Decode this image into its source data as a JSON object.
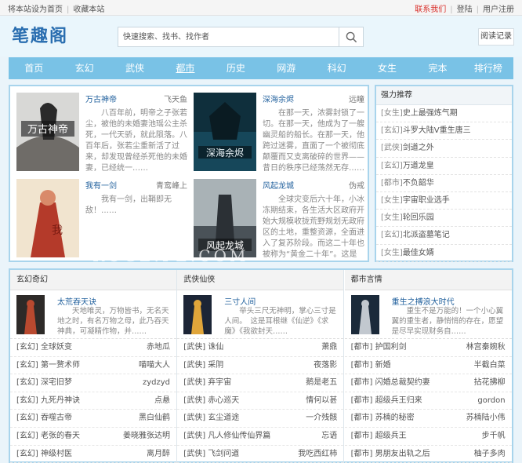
{
  "topbar": {
    "set_home": "将本站设为首页",
    "bookmark": "收藏本站",
    "contact": "联系我们",
    "login": "登陆",
    "register": "用户注册"
  },
  "header": {
    "logo": "笔趣阁",
    "search_placeholder": "快速搜索、找书、找作者",
    "history": "阅读记录"
  },
  "nav": [
    "首页",
    "玄幻",
    "武侠",
    "都市",
    "历史",
    "网游",
    "科幻",
    "女生",
    "完本",
    "排行榜"
  ],
  "nav_active": 3,
  "featured": [
    {
      "title": "万古神帝",
      "author": "飞天鱼",
      "desc": "八百年前，明帝之子张若尘，被他的未婚妻池瑶公主杀死，一代天骄，就此陨落。八百年后，张若尘重新活了过来，却发现曾经杀死他的未婚妻，已经统一……"
    },
    {
      "title": "深海余烬",
      "author": "远瞳",
      "desc": "在那一天，浓雾封锁了一切。在那一天，他成为了一艘幽灵船的船长。在那一天，他跨过迷雾，直面了一个被彻底颠覆而又支离破碎的世界——昔日的秩序已经荡然无存……"
    },
    {
      "title": "我有一剑",
      "author": "青鸾峰上",
      "desc": "我有一剑，出鞘即无敌！……"
    },
    {
      "title": "风起龙城",
      "author": "伪戒",
      "desc": "全球灾变后六十年，小冰冻期结束，各生活大区政府开始大规模收拢荒野规划无政府区的土地，重整资源，全面进入了复苏阶段。而这二十年也被称为“黄金二十年”。这是一个新……"
    }
  ],
  "hot": {
    "title": "强力推荐",
    "items": [
      {
        "tag": "[女生]",
        "name": "史上最强炼气期"
      },
      {
        "tag": "[玄幻]",
        "name": "斗罗大陆V重生唐三"
      },
      {
        "tag": "[武侠]",
        "name": "剑道之外"
      },
      {
        "tag": "[玄幻]",
        "name": "万道龙皇"
      },
      {
        "tag": "[都市]",
        "name": "不负韶华"
      },
      {
        "tag": "[女生]",
        "name": "宇宙职业选手"
      },
      {
        "tag": "[女生]",
        "name": "轮回乐园"
      },
      {
        "tag": "[玄幻]",
        "name": "北派盗墓笔记"
      },
      {
        "tag": "[女生]",
        "name": "最佳女婿"
      }
    ]
  },
  "categories": [
    {
      "name": "玄幻奇幻",
      "top": {
        "title": "太荒吞天诀",
        "desc": "天地唯灵，万物皆书，无名天地之时，有名万物之母，此乃吞天神典，可凝精作物，并……"
      },
      "rows": [
        {
          "title": "[玄幻] 全球妖变",
          "author": "赤地瓜"
        },
        {
          "title": "[玄幻] 第一赘术师",
          "author": "喵喵大人"
        },
        {
          "title": "[玄幻] 深宅旧梦",
          "author": "zydzyd"
        },
        {
          "title": "[玄幻] 九死丹神诀",
          "author": "点悬"
        },
        {
          "title": "[玄幻] 吞噬古帝",
          "author": "黑白仙鹤"
        },
        {
          "title": "[玄幻] 老张的春天",
          "author": "姜晓雅张达明"
        },
        {
          "title": "[玄幻] 神级村医",
          "author": "离月醉"
        }
      ]
    },
    {
      "name": "武侠仙侠",
      "top": {
        "title": "三寸人间",
        "desc": "举头三尺无神明，掌心三寸是人间。　这是耳根继《仙逆》《求魔》《我欲封天……"
      },
      "rows": [
        {
          "title": "[武侠] 诛仙",
          "author": "萧鼎"
        },
        {
          "title": "[武侠] 采阴",
          "author": "夜落影"
        },
        {
          "title": "[武侠] 弃宇宙",
          "author": "鹅是老五"
        },
        {
          "title": "[武侠] 赤心巡天",
          "author": "情何以甚"
        },
        {
          "title": "[武侠] 玄尘道途",
          "author": "一介残骸"
        },
        {
          "title": "[武侠] 凡人修仙传仙界篇",
          "author": "忘语"
        },
        {
          "title": "[武侠] 飞剑问道",
          "author": "我吃西红柿"
        }
      ]
    },
    {
      "name": "都市言情",
      "top": {
        "title": "重生之搏浪大时代",
        "desc": "重生不是万能的！一个小心翼翼的重生者，静悄悄的存在，愿望是尽早实现财务自……"
      },
      "rows": [
        {
          "title": "[都市] 护国利剑",
          "author": "林宫秦婉秋"
        },
        {
          "title": "[都市] 新婚",
          "author": "半截白菜"
        },
        {
          "title": "[都市] 闪婚总裁契约妻",
          "author": "拈花拂柳"
        },
        {
          "title": "[都市] 超级兵王归来",
          "author": "gordon"
        },
        {
          "title": "[都市] 苏楠的秘密",
          "author": "苏楠陆小伟"
        },
        {
          "title": "[都市] 超级兵王",
          "author": "步千帆"
        },
        {
          "title": "[都市] 男朋友出轨之后",
          "author": "柚子多肉"
        }
      ]
    }
  ],
  "watermark": "RUGE.PE.COM",
  "colors": {
    "nav": "#79c2e6",
    "border": "#a8d4ec",
    "link": "#1f5f9c",
    "accent_red": "#d9302b"
  }
}
